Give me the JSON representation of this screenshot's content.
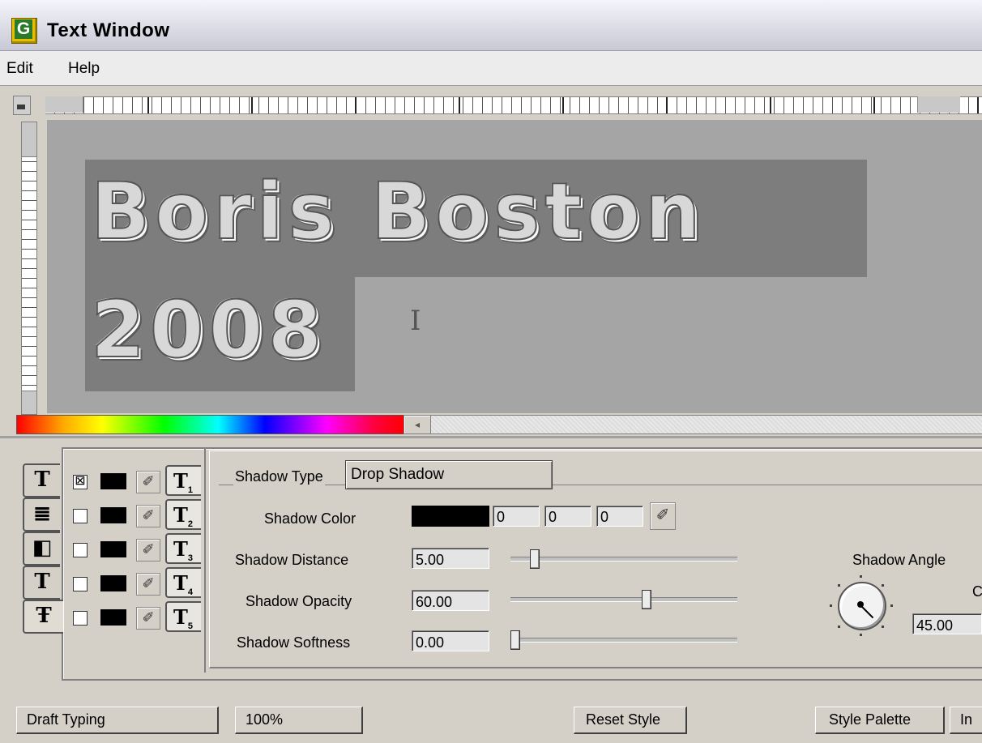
{
  "window": {
    "title": "Text Window",
    "app_icon_letter": "G"
  },
  "menu": {
    "items": [
      "Edit",
      "Help"
    ]
  },
  "canvas": {
    "lines": [
      "Boris Boston",
      "2008"
    ],
    "cursor_glyph": "I"
  },
  "style_panel": {
    "side_tabs": [
      {
        "glyph": "T",
        "icon": "text-fill-icon"
      },
      {
        "glyph": "≣",
        "icon": "paragraph-icon"
      },
      {
        "glyph": "◧",
        "icon": "gradient-icon"
      },
      {
        "glyph": "T",
        "icon": "outline-text-icon"
      },
      {
        "glyph": "Ŧ",
        "icon": "shadow-text-icon"
      }
    ],
    "layer_rows": [
      {
        "checked": true,
        "check_glyph": "⊠",
        "swatch_color": "#000000",
        "tab_glyph": "T",
        "tab_index": "1"
      },
      {
        "checked": false,
        "check_glyph": "",
        "swatch_color": "#000000",
        "tab_glyph": "T",
        "tab_index": "2"
      },
      {
        "checked": false,
        "check_glyph": "",
        "swatch_color": "#000000",
        "tab_glyph": "T",
        "tab_index": "3"
      },
      {
        "checked": false,
        "check_glyph": "",
        "swatch_color": "#000000",
        "tab_glyph": "T",
        "tab_index": "4"
      },
      {
        "checked": false,
        "check_glyph": "",
        "swatch_color": "#000000",
        "tab_glyph": "T",
        "tab_index": "5"
      }
    ],
    "dropper_glyph": "✐"
  },
  "shadow": {
    "type_label": "Shadow Type",
    "type_value": "Drop Shadow",
    "color_label": "Shadow Color",
    "color_swatch": "#000000",
    "color_r": "0",
    "color_g": "0",
    "color_b": "0",
    "distance_label": "Shadow Distance",
    "distance_value": "5.00",
    "distance_level": 0.09,
    "opacity_label": "Shadow Opacity",
    "opacity_value": "60.00",
    "opacity_level": 0.6,
    "softness_label": "Shadow Softness",
    "softness_value": "0.00",
    "softness_level": 0.0,
    "angle_label": "Shadow Angle",
    "angle_value": "45.00",
    "angle_extra": "C"
  },
  "bottom_bar": {
    "draft_typing": "Draft Typing",
    "zoom": "100%",
    "reset_style": "Reset Style",
    "style_palette": "Style Palette",
    "cut_button": "In"
  },
  "colors": {
    "canvas_bg": "#a5a5a5",
    "text_highlight": "#7d7d7d",
    "app_icon": "#e6c000"
  }
}
